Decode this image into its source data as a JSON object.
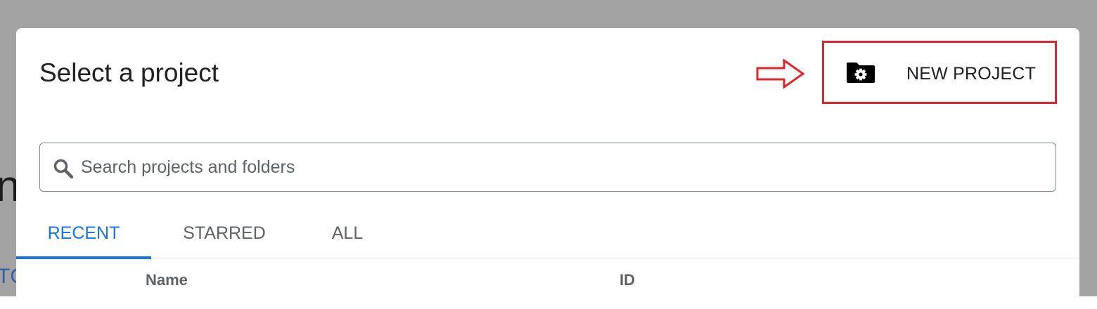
{
  "dialog": {
    "title": "Select a project",
    "new_project_label": "NEW PROJECT"
  },
  "search": {
    "placeholder": "Search projects and folders",
    "value": ""
  },
  "tabs": [
    {
      "label": "RECENT",
      "active": true
    },
    {
      "label": "STARRED",
      "active": false
    },
    {
      "label": "ALL",
      "active": false
    }
  ],
  "table": {
    "columns": [
      "Name",
      "ID"
    ]
  },
  "background": {
    "heading_fragment": "n",
    "link_fragment": "TC"
  },
  "colors": {
    "accent": "#1a73e8",
    "highlight": "#e0262d",
    "backdrop": "#a3a3a3"
  },
  "icons": {
    "new_project": "folder-gear-icon",
    "search": "search-icon",
    "callout": "arrow-right-icon"
  }
}
